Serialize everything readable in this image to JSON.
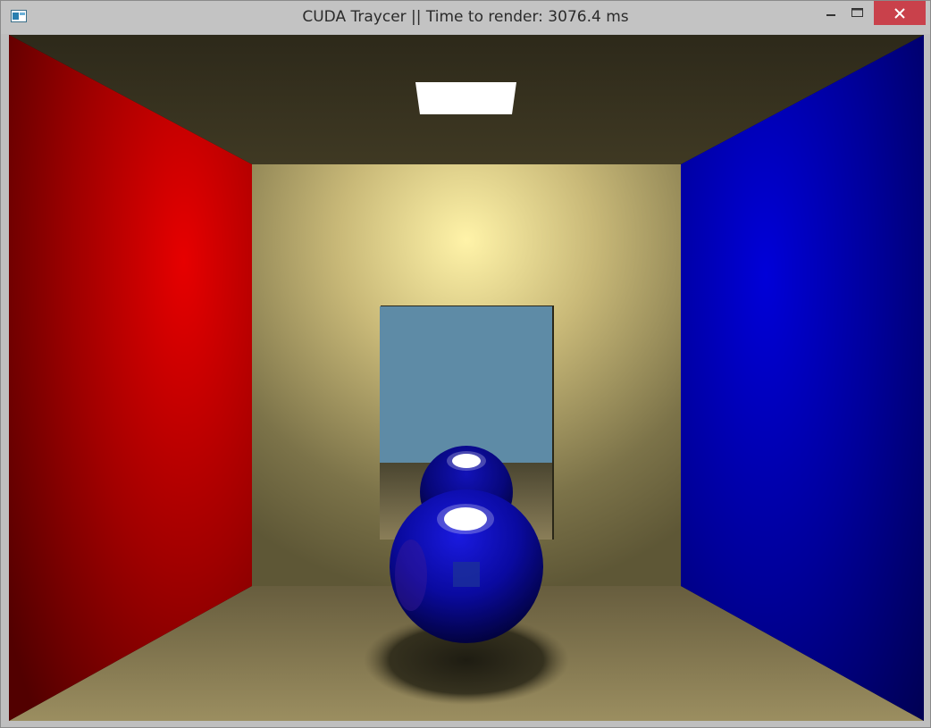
{
  "window": {
    "title": "CUDA Traycer || Time to render: 3076.4 ms",
    "icon": "application-icon",
    "controls": {
      "minimize": "minimize-icon",
      "maximize": "maximize-icon",
      "close": "close-icon"
    }
  },
  "scene": {
    "left_wall_color": "#dd0000",
    "right_wall_color": "#0000cc",
    "back_wall_color": "#f5e8a0",
    "floor_color": "#8e8258",
    "ceiling_color": "#302b1c",
    "mirror_color": "#5e8ba6",
    "sphere_color": "#0a0aa8",
    "light_color": "#ffffff"
  }
}
